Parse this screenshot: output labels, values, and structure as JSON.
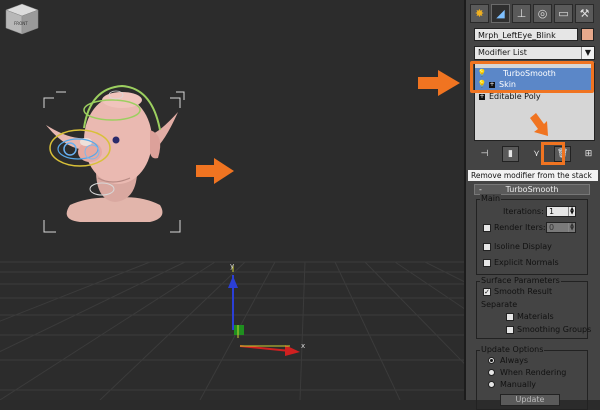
{
  "viewport": {
    "viewcube_label": "FRONT",
    "axis_x": "x",
    "axis_y": "y"
  },
  "panel": {
    "tabs": [
      {
        "name": "create-tab-icon",
        "glyph": "✸"
      },
      {
        "name": "modify-tab-icon",
        "glyph": "◢"
      },
      {
        "name": "hierarchy-tab-icon",
        "glyph": "⊥"
      },
      {
        "name": "motion-tab-icon",
        "glyph": "◎"
      },
      {
        "name": "display-tab-icon",
        "glyph": "▭"
      },
      {
        "name": "utilities-tab-icon",
        "glyph": "⚒"
      }
    ],
    "object_name": "Mrph_LeftEye_Blink",
    "object_color": "#e7a98c",
    "modifier_list": "Modifier List",
    "stack": [
      "TurboSmooth",
      "Skin",
      "Editable Poly"
    ],
    "tooltip": "Remove modifier from the stack",
    "rollout_title": "TurboSmooth",
    "main": {
      "label": "Main",
      "iterations_label": "Iterations:",
      "iterations_value": "1",
      "render_iters_label": "Render Iters:",
      "render_iters_value": "0",
      "isoline_label": "Isoline Display",
      "explicit_normals_label": "Explicit Normals"
    },
    "surface": {
      "label": "Surface Parameters",
      "smooth_result_label": "Smooth Result",
      "separate_label": "Separate",
      "materials_label": "Materials",
      "smoothing_groups_label": "Smoothing Groups"
    },
    "update": {
      "label": "Update Options",
      "always_label": "Always",
      "when_rendering_label": "When Rendering",
      "manually_label": "Manually",
      "update_button_label": "Update"
    }
  },
  "colors": {
    "highlight": "#f07421",
    "selection": "#5b87c8"
  }
}
